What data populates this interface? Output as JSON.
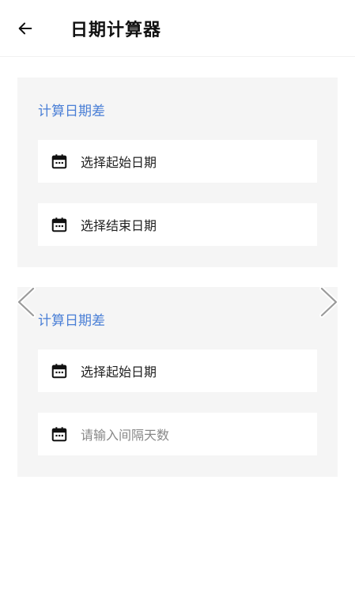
{
  "header": {
    "title": "日期计算器",
    "back_icon": "arrow-left-icon"
  },
  "cards": [
    {
      "title": "计算日期差",
      "rows": [
        {
          "label": "选择起始日期",
          "icon": "calendar-icon"
        },
        {
          "label": "选择结束日期",
          "icon": "calendar-icon"
        }
      ]
    },
    {
      "title": "计算日期差",
      "rows": [
        {
          "label": "选择起始日期",
          "icon": "calendar-icon"
        },
        {
          "placeholder": "请输入间隔天数",
          "icon": "calendar-icon"
        }
      ]
    }
  ],
  "colors": {
    "accent": "#4a7fd6",
    "card_bg": "#f5f5f5",
    "text": "#222222",
    "placeholder": "#888888"
  }
}
